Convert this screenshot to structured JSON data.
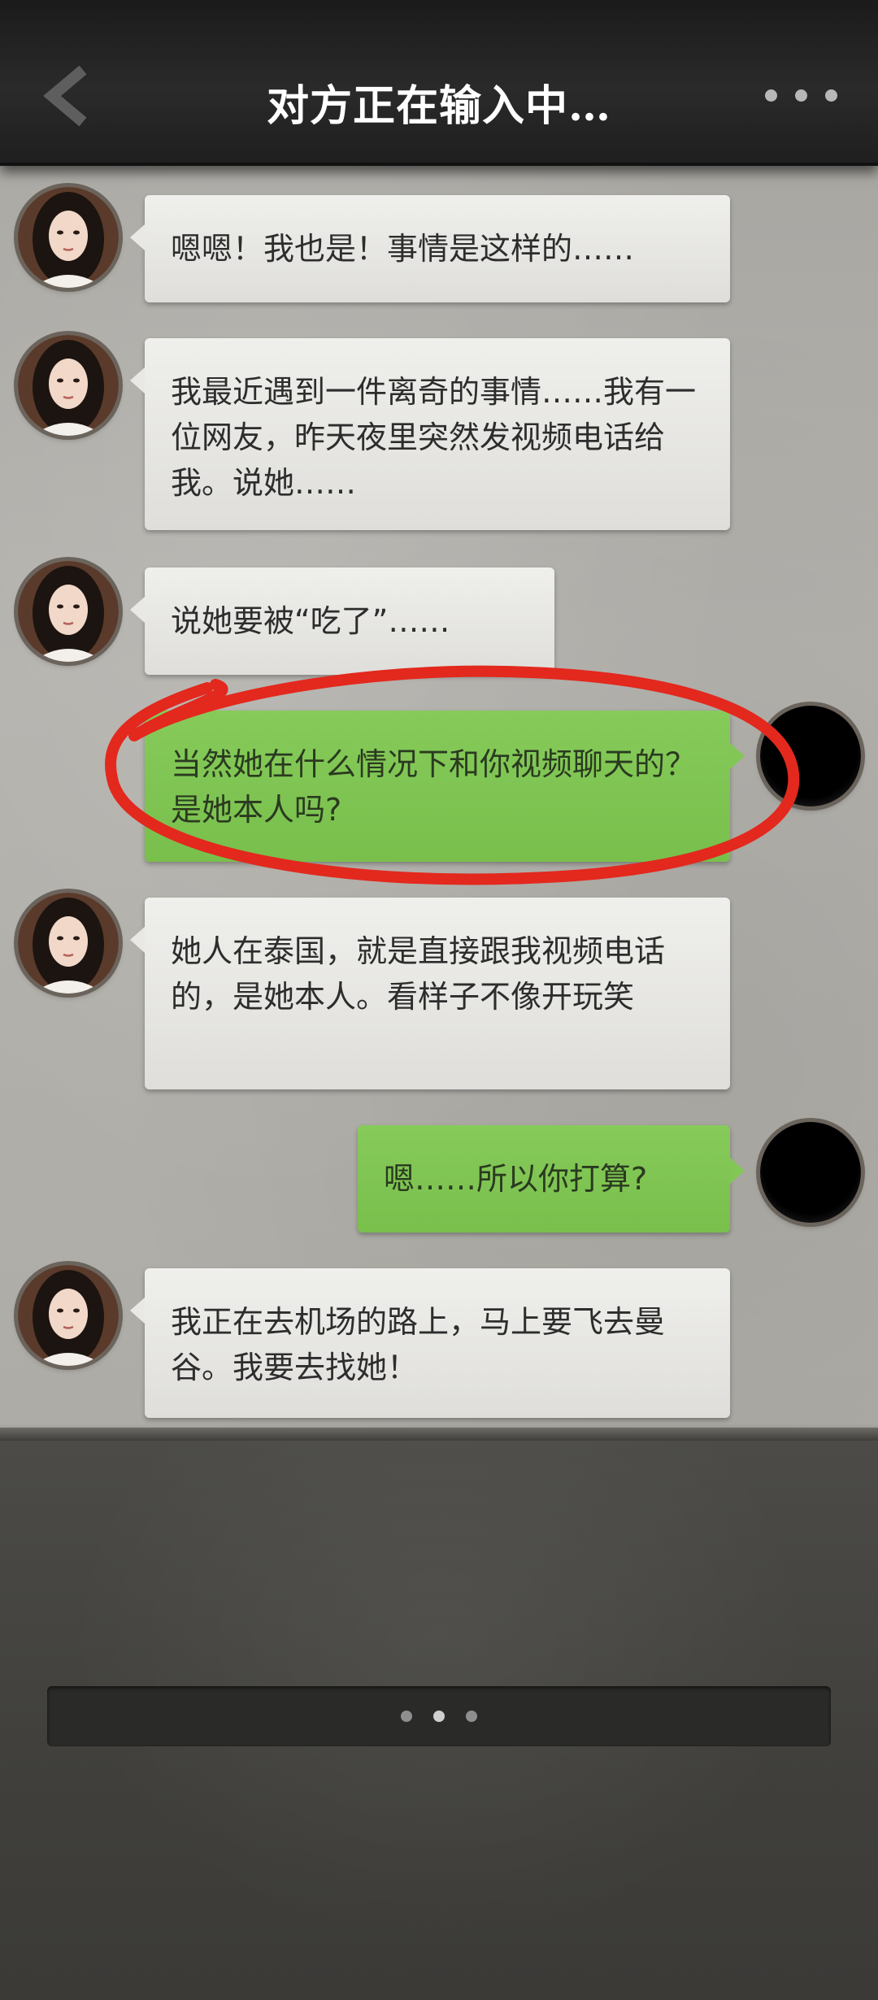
{
  "header": {
    "title": "对方正在输入中…",
    "back_icon": "chevron-left-icon",
    "more_icon": "more-dots-icon"
  },
  "messages": [
    {
      "side": "left",
      "text": "嗯嗯！我也是！事情是这样的……"
    },
    {
      "side": "left",
      "text": "我最近遇到一件离奇的事情……我有一位网友，昨天夜里突然发视频电话给我。说她……"
    },
    {
      "side": "left",
      "text": "说她要被“吃了”……"
    },
    {
      "side": "right",
      "text": "当然她在什么情况下和你视频聊天的？是她本人吗?"
    },
    {
      "side": "left",
      "text": "她人在泰国，就是直接跟我视频电话的，是她本人。看样子不像开玩笑"
    },
    {
      "side": "right",
      "text": "嗯……所以你打算?"
    },
    {
      "side": "left",
      "text": "我正在去机场的路上，马上要飞去曼谷。我要去找她！"
    }
  ],
  "colors": {
    "bubble_incoming": "#e6e5e2",
    "bubble_outgoing": "#7dc44f",
    "annotation_circle": "#e3281d"
  },
  "input_bar": {
    "icon": "ellipsis-icon"
  }
}
